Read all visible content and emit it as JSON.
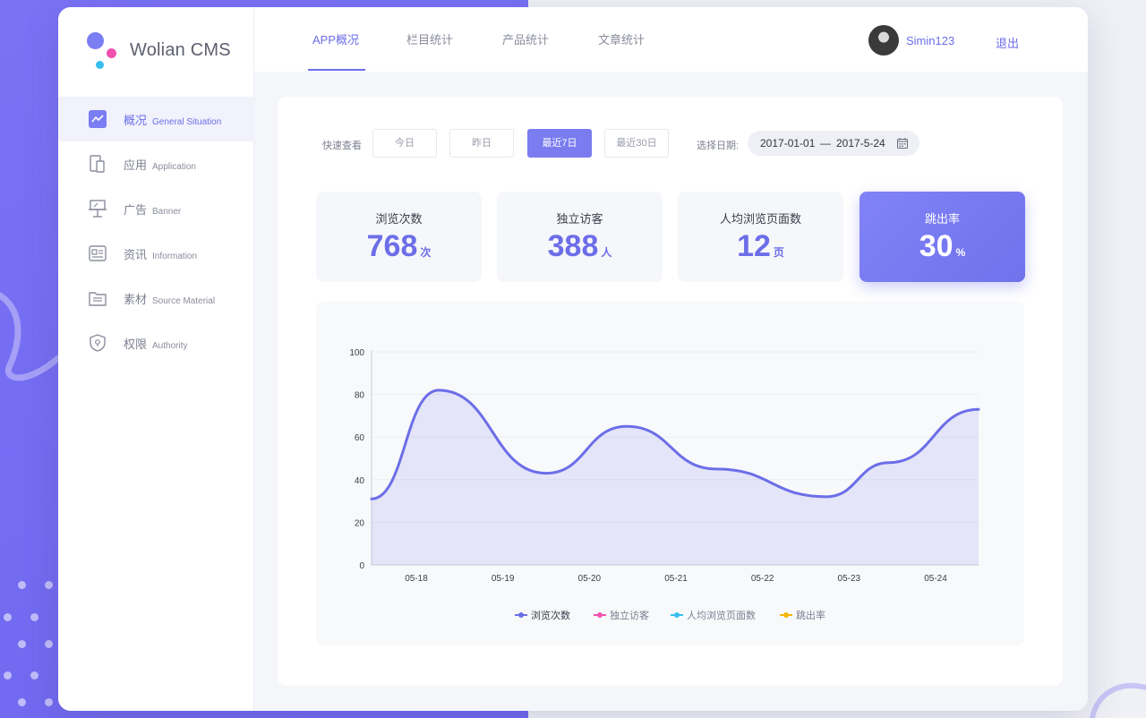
{
  "brand": {
    "name": "Wolian CMS",
    "dot_colors": [
      "#7b7df3",
      "#f052b0",
      "#35c0ef"
    ]
  },
  "sidebar": {
    "items": [
      {
        "zh": "概况",
        "en": "General Situation",
        "icon": "trend-chart-icon",
        "active": true
      },
      {
        "zh": "应用",
        "en": "Application",
        "icon": "devices-icon",
        "active": false
      },
      {
        "zh": "广告",
        "en": "Banner",
        "icon": "easel-icon",
        "active": false
      },
      {
        "zh": "资讯",
        "en": "Information",
        "icon": "news-icon",
        "active": false
      },
      {
        "zh": "素材",
        "en": "Source Material",
        "icon": "folder-icon",
        "active": false
      },
      {
        "zh": "权限",
        "en": "Authority",
        "icon": "shield-icon",
        "active": false
      }
    ]
  },
  "header": {
    "tabs": [
      {
        "label": "APP概况",
        "active": true
      },
      {
        "label": "栏目统计",
        "active": false
      },
      {
        "label": "产品统计",
        "active": false
      },
      {
        "label": "文章统计",
        "active": false
      }
    ],
    "username": "Simin123",
    "logout": "退出"
  },
  "filters": {
    "quick_label": "快速查看",
    "quick_options": [
      {
        "label": "今日",
        "active": false
      },
      {
        "label": "昨日",
        "active": false
      },
      {
        "label": "最近7日",
        "active": true
      },
      {
        "label": "最近30日",
        "active": false
      }
    ],
    "date_label": "选择日期:",
    "date_start": "2017-01-01",
    "date_sep": "—",
    "date_end": "2017-5-24"
  },
  "stats": [
    {
      "title": "浏览次数",
      "value": "768",
      "unit": "次",
      "active": false
    },
    {
      "title": "独立访客",
      "value": "388",
      "unit": "人",
      "active": false
    },
    {
      "title": "人均浏览页面数",
      "value": "12",
      "unit": "页",
      "active": false
    },
    {
      "title": "跳出率",
      "value": "30",
      "unit": "%",
      "active": true
    }
  ],
  "colors": {
    "accent": "#6c6ee8",
    "accent_fill": "#7a7cf0"
  },
  "chart_data": {
    "type": "area",
    "categories": [
      "05-18",
      "05-19",
      "05-20",
      "05-21",
      "05-22",
      "05-23",
      "05-24"
    ],
    "x_start": "05-17.5",
    "ylim": [
      0,
      100
    ],
    "yticks": [
      0,
      20,
      40,
      60,
      80,
      100
    ],
    "grid": true,
    "legend_placement": "bottom",
    "series": [
      {
        "name": "浏览次数",
        "color": "#6c6ee8",
        "active": true,
        "points": [
          31,
          82,
          43,
          65,
          45,
          32,
          48,
          73
        ]
      }
    ],
    "legend": [
      {
        "name": "浏览次数",
        "color": "#6c6ee8",
        "active": true
      },
      {
        "name": "独立访客",
        "color": "#f052b0",
        "active": false
      },
      {
        "name": "人均浏览页面数",
        "color": "#35c0ef",
        "active": false
      },
      {
        "name": "跳出率",
        "color": "#f7b500",
        "active": false
      }
    ]
  }
}
